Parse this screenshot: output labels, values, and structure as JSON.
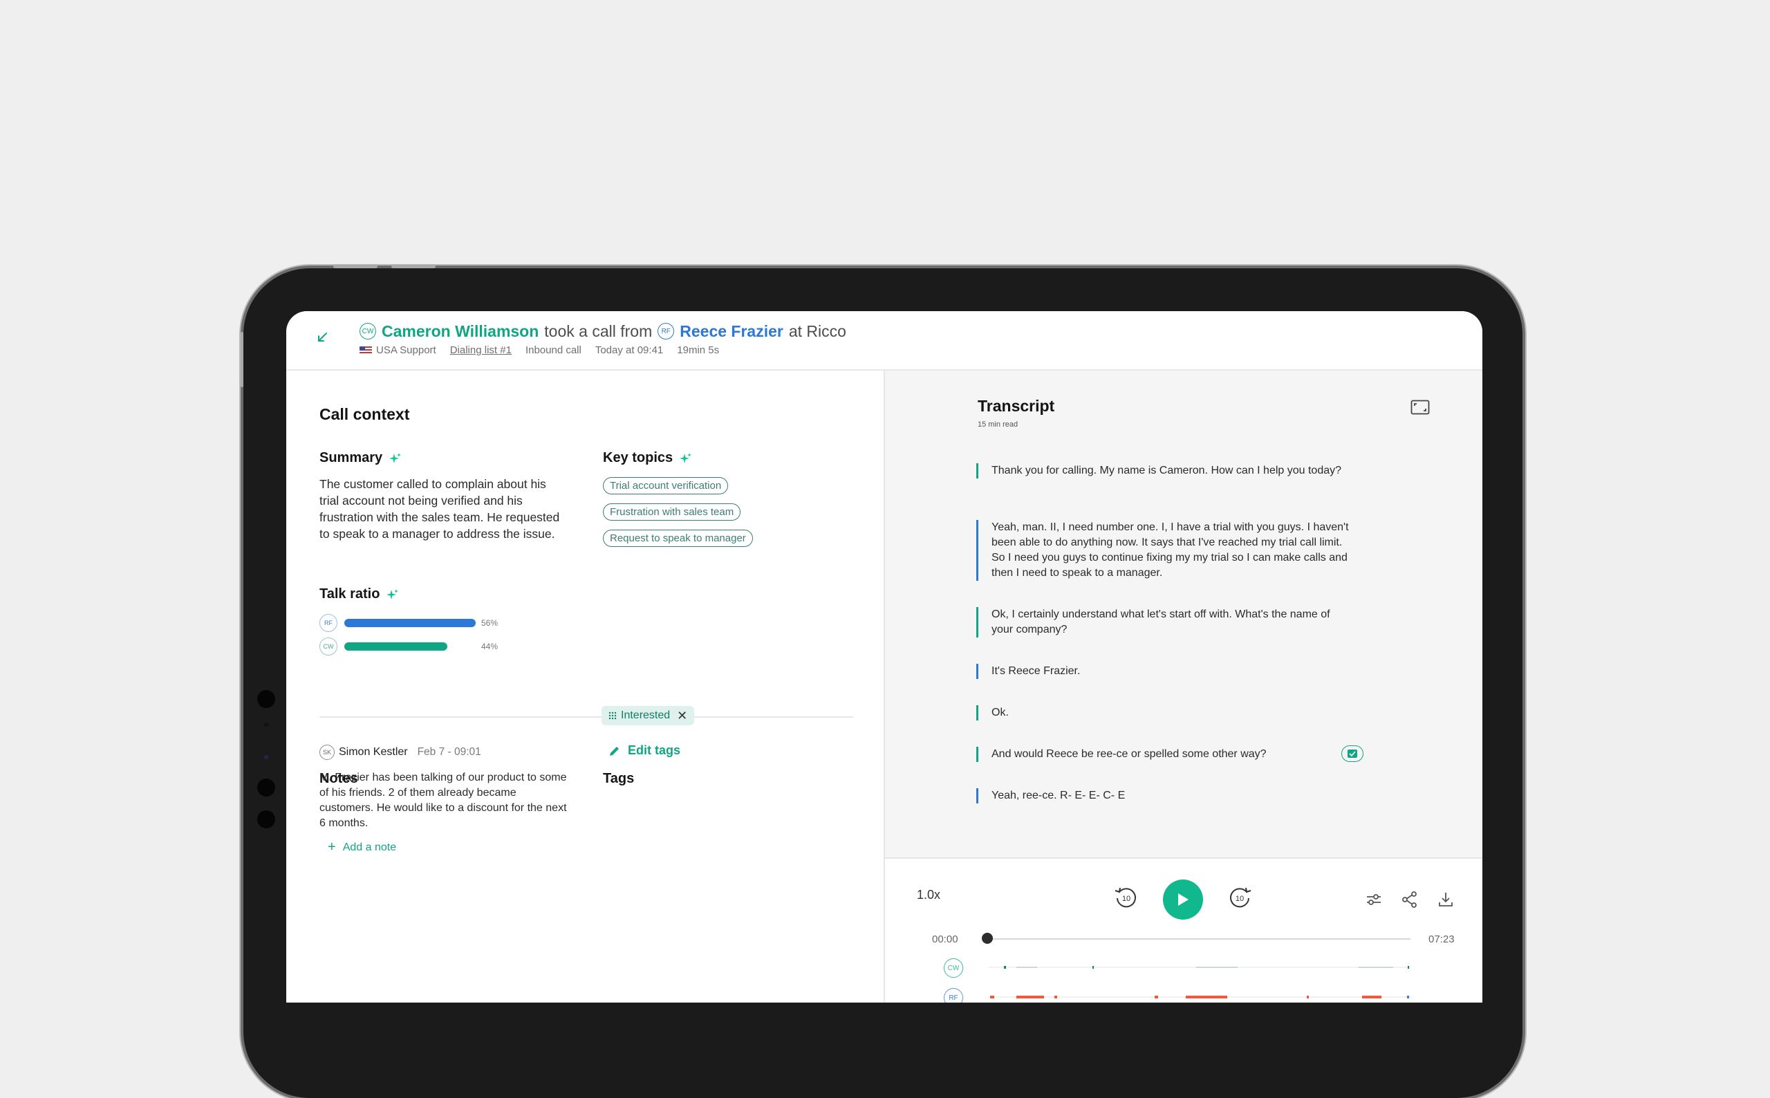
{
  "header": {
    "agent_initials": "CW",
    "agent_name": "Cameron Williamson",
    "verb": "took a call from",
    "caller_initials": "RF",
    "caller_name": "Reece Frazier",
    "company": "at Ricco",
    "team": "USA Support",
    "dialing_list": "Dialing list #1",
    "call_type": "Inbound call",
    "time": "Today at 09:41",
    "duration": "19min 5s"
  },
  "context": {
    "title": "Call context",
    "summary_title": "Summary",
    "summary_text": "The customer called to complain about his trial account not being verified and his frustration with the sales team. He requested to speak to a manager to address the issue.",
    "topics_title": "Key topics",
    "topics": [
      "Trial account verification",
      "Frustration with sales team",
      "Request to speak to manager"
    ],
    "talk_ratio_title": "Talk ratio",
    "talk_ratio": [
      {
        "initials": "RF",
        "value": 0.56,
        "label": "56%",
        "color": "#2a78d8"
      },
      {
        "initials": "CW",
        "value": 0.44,
        "label": "44%",
        "color": "#11a683"
      }
    ]
  },
  "notes": {
    "title": "Notes",
    "author_initials": "SK",
    "author": "Simon Kestler",
    "date": "Feb 7 - 09:01",
    "text": "M. Frazier has been talking of our product to some of his friends. 2 of them already became customers. He would like to a discount for the next 6 months.",
    "add_label": "Add a note"
  },
  "tags": {
    "title": "Tags",
    "items": [
      "Interested"
    ],
    "edit_label": "Edit tags"
  },
  "transcript": {
    "title": "Transcript",
    "subtitle": "15 min read",
    "entries": [
      {
        "speaker": "CW",
        "text": "Thank you for calling. My name is Cameron. How can I help you today?"
      },
      {
        "speaker": "RF",
        "text": "Yeah, man. II, I need number one. I, I have a trial with you guys. I haven't been able to do anything now. It says that I've reached my trial call limit. So I need you guys to continue fixing my my trial so I can make calls and then I need to speak to a manager."
      },
      {
        "speaker": "CW",
        "text": "Ok, I certainly understand what let's start off with. What's the name of your company?"
      },
      {
        "speaker": "RF",
        "text": "It's Reece Frazier."
      },
      {
        "speaker": "CW",
        "text": "Ok."
      },
      {
        "speaker": "CW",
        "text": "And would Reece be ree-ce or spelled some other way?"
      },
      {
        "speaker": "RF",
        "text": "Yeah, ree-ce. R- E- E- C- E"
      }
    ]
  },
  "player": {
    "speed": "1.0x",
    "skip_back": "10",
    "skip_forward": "10",
    "time_start": "00:00",
    "time_end": "07:23",
    "lane_cw": "CW",
    "lane_rf": "RF"
  },
  "colors": {
    "accent": "#11a683",
    "blue": "#2a78d8",
    "red": "#f0593e"
  }
}
